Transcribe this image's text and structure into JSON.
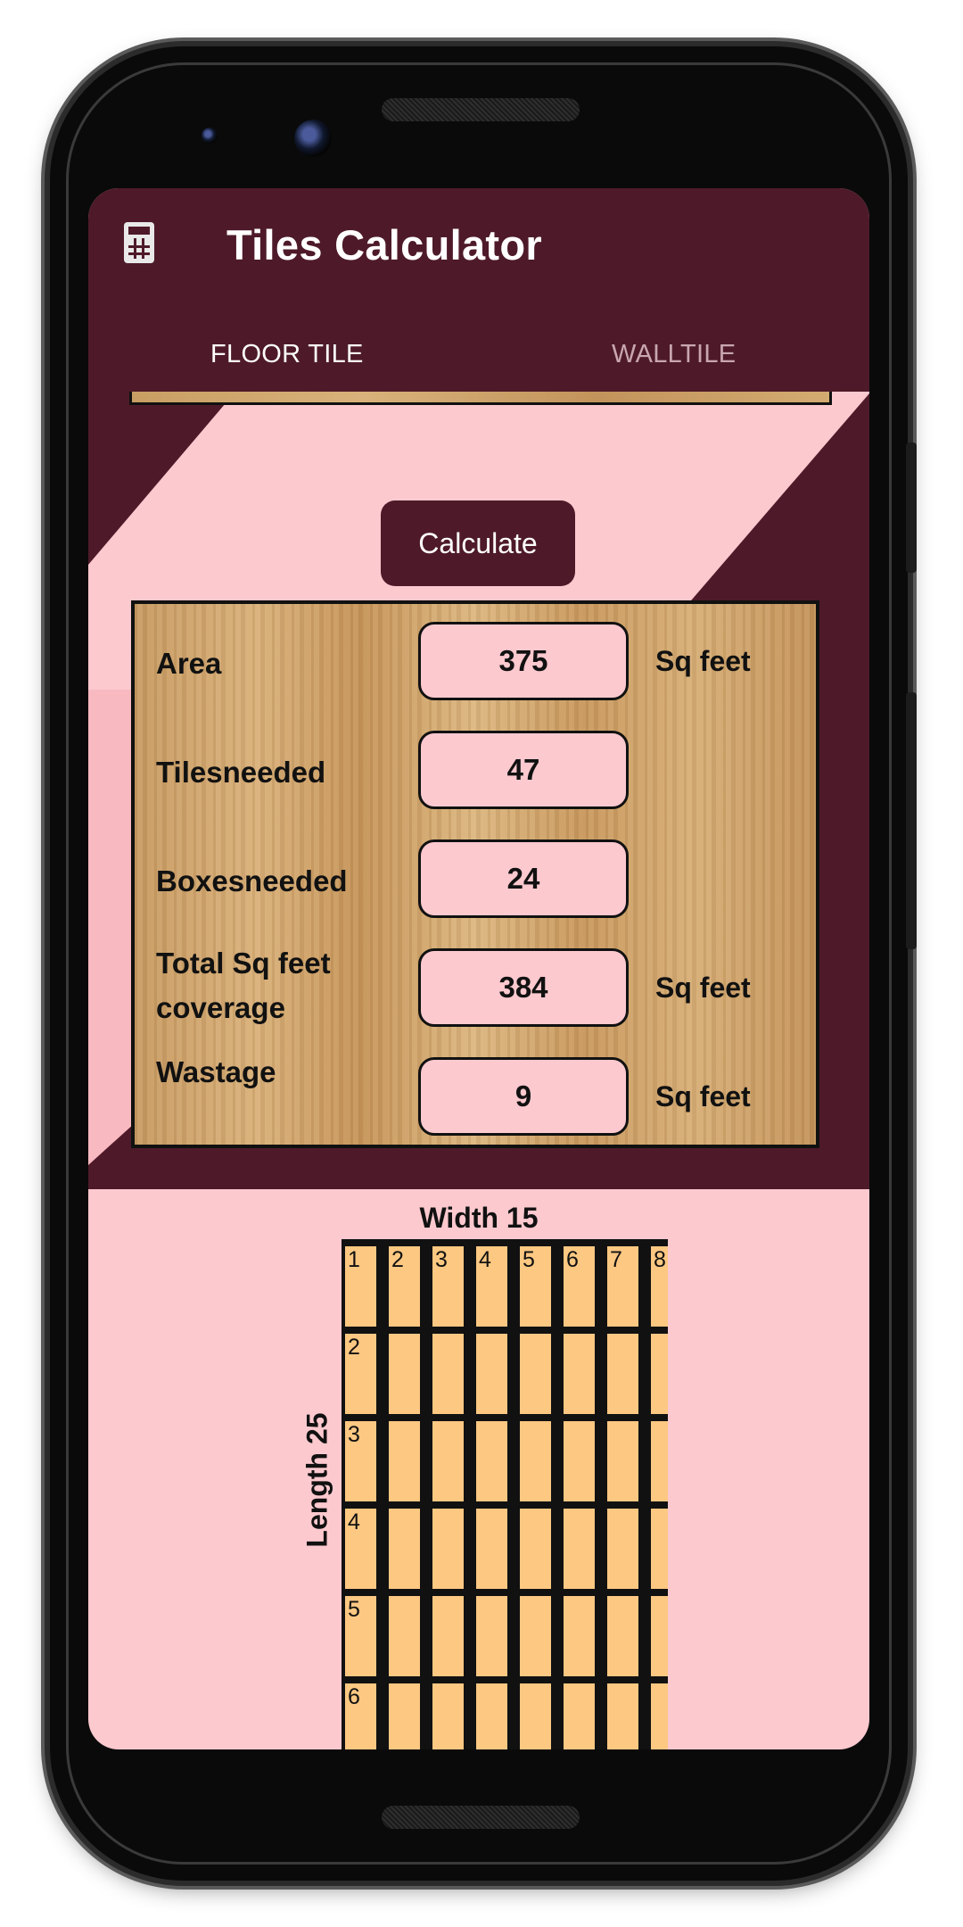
{
  "app": {
    "title": "Tiles Calculator",
    "icon": "calculator-icon",
    "colors": {
      "primary": "#4e1a29",
      "accent_bg": "#fcc9cf",
      "tile": "#fdc882"
    }
  },
  "tabs": [
    {
      "label": "FLOOR TILE",
      "selected": true
    },
    {
      "label": "WALLTILE",
      "selected": false
    }
  ],
  "calculate_button": {
    "label": "Calculate"
  },
  "results": [
    {
      "label": "Area",
      "value": "375",
      "unit": "Sq feet"
    },
    {
      "label": "Tilesneeded",
      "value": "47",
      "unit": ""
    },
    {
      "label": "Boxesneeded",
      "value": "24",
      "unit": ""
    },
    {
      "label": "Total Sq feet coverage",
      "value": "384",
      "unit": "Sq feet"
    },
    {
      "label": "Wastage",
      "value": "9",
      "unit": "Sq feet"
    }
  ],
  "layout_preview": {
    "width_label": "Width 15",
    "length_label": "Length 25",
    "column_numbers": [
      "1",
      "2",
      "3",
      "4",
      "5",
      "6",
      "7",
      "8"
    ],
    "row_numbers": [
      "1",
      "2",
      "3",
      "4",
      "5",
      "6"
    ]
  }
}
